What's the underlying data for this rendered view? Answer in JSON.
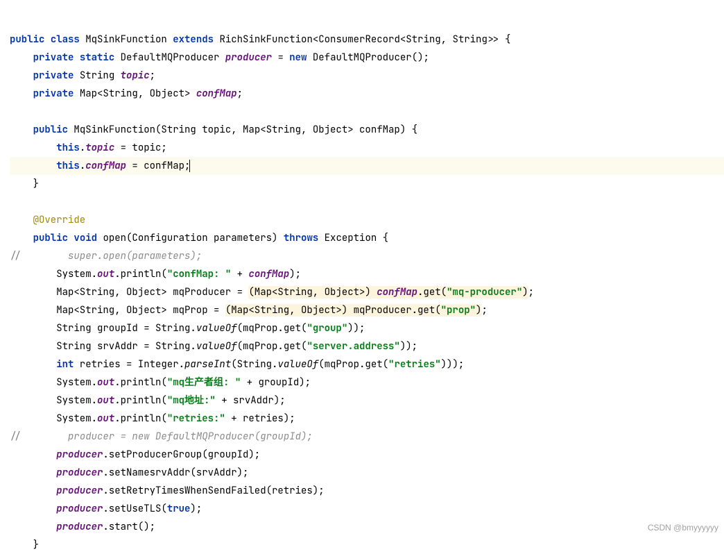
{
  "code": {
    "l1_kw_public": "public",
    "l1_kw_class": "class",
    "l1_class": "MqSinkFunction",
    "l1_kw_extends": "extends",
    "l1_super": "RichSinkFunction<ConsumerRecord<String, String>>",
    "l2_kw_private": "private",
    "l2_kw_static": "static",
    "l2_type": "DefaultMQProducer",
    "l2_field": "producer",
    "l2_kw_new": "new",
    "l2_ctor": "DefaultMQProducer()",
    "l3_kw_private": "private",
    "l3_type": "String",
    "l3_field": "topic",
    "l4_kw_private": "private",
    "l4_type": "Map<String, Object>",
    "l4_field": "confMap",
    "l6_kw_public": "public",
    "l6_ctor": "MqSinkFunction(String topic, Map<String, Object> confMap)",
    "l7_this": "this",
    "l7_field": "topic",
    "l7_rhs": "topic",
    "l8_this": "this",
    "l8_field": "confMap",
    "l8_rhs": "confMap",
    "ann_override": "@Override",
    "l11_kw_public": "public",
    "l11_kw_void": "void",
    "l11_method": "open(Configuration parameters)",
    "l11_kw_throws": "throws",
    "l11_exc": "Exception",
    "c_super": "super.open(parameters);",
    "p1a": "System.",
    "out": "out",
    "p1b": ".println(",
    "p1str": "\"confMap: \"",
    "plus": " + ",
    "p1field": "confMap",
    "l14_lhs": "Map<String, Object> mqProducer = ",
    "l14_cast": "(Map<String, Object>) ",
    "l14_obj": "confMap",
    "l14_get": ".get(",
    "l14_key": "\"mq-producer\"",
    "l15_lhs": "Map<String, Object> mqProp = ",
    "l15_cast": "(Map<String, Object>) ",
    "l15_obj": "mqProducer.get(",
    "l15_key": "\"prop\"",
    "l16": "String groupId = String.",
    "valueOf": "valueOf",
    "l16b": "(mqProp.get(",
    "l16key": "\"group\"",
    "l17": "String srvAddr = String.",
    "l17b": "(mqProp.get(",
    "l17key": "\"server.address\"",
    "l18kw": "int",
    "l18a": " retries = Integer.",
    "parseInt": "parseInt",
    "l18b": "(String.",
    "l18c": "(mqProp.get(",
    "l18key": "\"retries\"",
    "p2str": "\"mq生产者组: \"",
    "p2var": "groupId",
    "p3str": "\"mq地址:\"",
    "p3var": "srvAddr",
    "p4str": "\"retries:\"",
    "p4var": "retries",
    "c_prod": "producer = new DefaultMQProducer(groupId);",
    "prod": "producer",
    "m1": ".setProducerGroup(groupId);",
    "m2": ".setNamesrvAddr(srvAddr);",
    "m3": ".setRetryTimesWhenSendFailed(retries);",
    "m4a": ".setUseTLS(",
    "true": "true",
    "m5": ".start();",
    "watermark": "CSDN @bmyyyyyy",
    "slashes": "//"
  }
}
